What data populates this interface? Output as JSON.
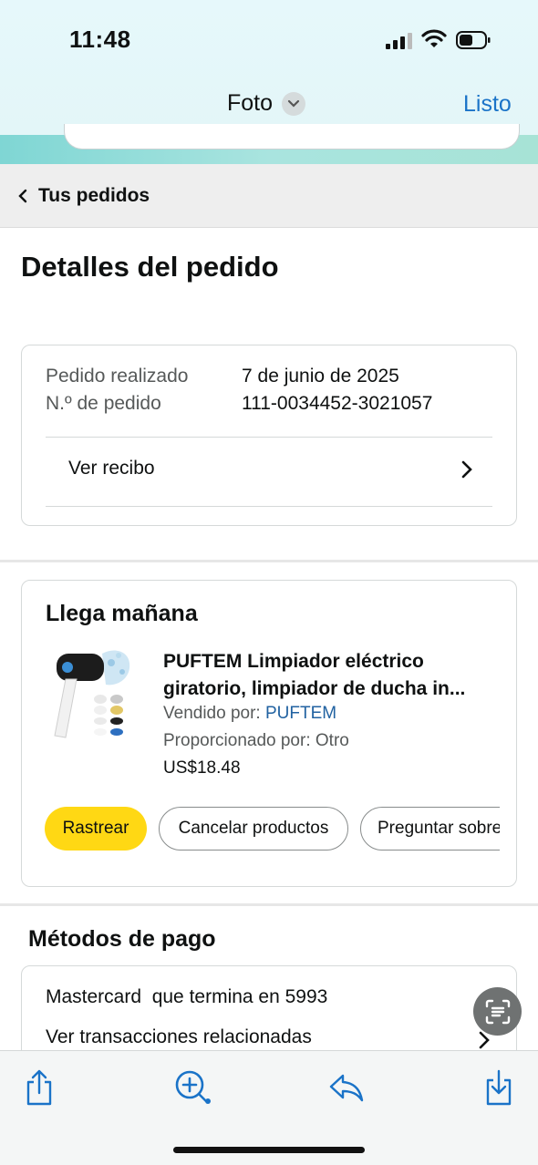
{
  "status": {
    "time": "11:48"
  },
  "nav": {
    "title": "Foto",
    "done": "Listo"
  },
  "breadcrumb": {
    "label": "Tus pedidos"
  },
  "page": {
    "title": "Detalles del pedido"
  },
  "order_info": {
    "placed_label": "Pedido realizado",
    "placed_value": "7 de junio de 2025",
    "number_label": "N.º de pedido",
    "number_value": "111-0034452-3021057",
    "receipt_label": "Ver recibo"
  },
  "shipment": {
    "heading": "Llega mañana",
    "product_title_1": "PUFTEM Limpiador eléctrico",
    "product_title_2": "giratorio, limpiador de ducha in...",
    "sold_by_label": "Vendido por:",
    "sold_by_value": "PUFTEM",
    "provided_by": "Proporcionado por: Otro",
    "price": "US$18.48",
    "buttons": {
      "track": "Rastrear",
      "cancel": "Cancelar productos",
      "ask": "Preguntar sobre"
    }
  },
  "payment": {
    "heading": "Métodos de pago",
    "card": "Mastercard  que termina en 5993",
    "related": "Ver transacciones relacionadas"
  },
  "colors": {
    "accent_blue": "#1a73c8",
    "track_yellow": "#ffd814",
    "link_blue": "#2162a1"
  },
  "icons": [
    "share-icon",
    "markup-icon",
    "reply-icon",
    "save-icon",
    "live-text-icon"
  ]
}
